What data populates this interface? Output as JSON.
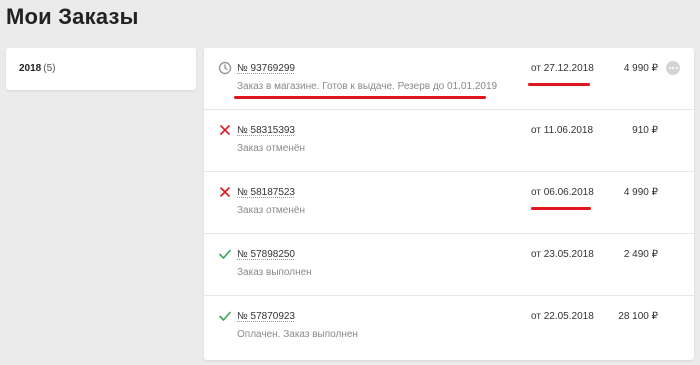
{
  "page": {
    "title": "Мои Заказы"
  },
  "years": [
    {
      "year": "2018",
      "count": "(5)"
    }
  ],
  "orders": [
    {
      "status_icon": "clock-icon",
      "number": "№ 93769299",
      "status": "Заказ в магазине. Готов к выдаче. Резерв до 01.01.2019",
      "date": "от 27.12.2018",
      "price": "4 990 ₽"
    },
    {
      "status_icon": "cross-icon",
      "number": "№ 58315393",
      "status": "Заказ отменён",
      "date": "от 11.06.2018",
      "price": "910 ₽"
    },
    {
      "status_icon": "cross-icon",
      "number": "№ 58187523",
      "status": "Заказ отменён",
      "date": "от 06.06.2018",
      "price": "4 990 ₽"
    },
    {
      "status_icon": "check-icon",
      "number": "№ 57898250",
      "status": "Заказ выполнен",
      "date": "от 23.05.2018",
      "price": "2 490 ₽"
    },
    {
      "status_icon": "check-icon",
      "number": "№ 57870923",
      "status": "Оплачен. Заказ выполнен",
      "date": "от 22.05.2018",
      "price": "28 100 ₽"
    }
  ],
  "colors": {
    "accent_red": "#e0161f",
    "check_green": "#3aa757",
    "clock_gray": "#9a9a9a"
  }
}
